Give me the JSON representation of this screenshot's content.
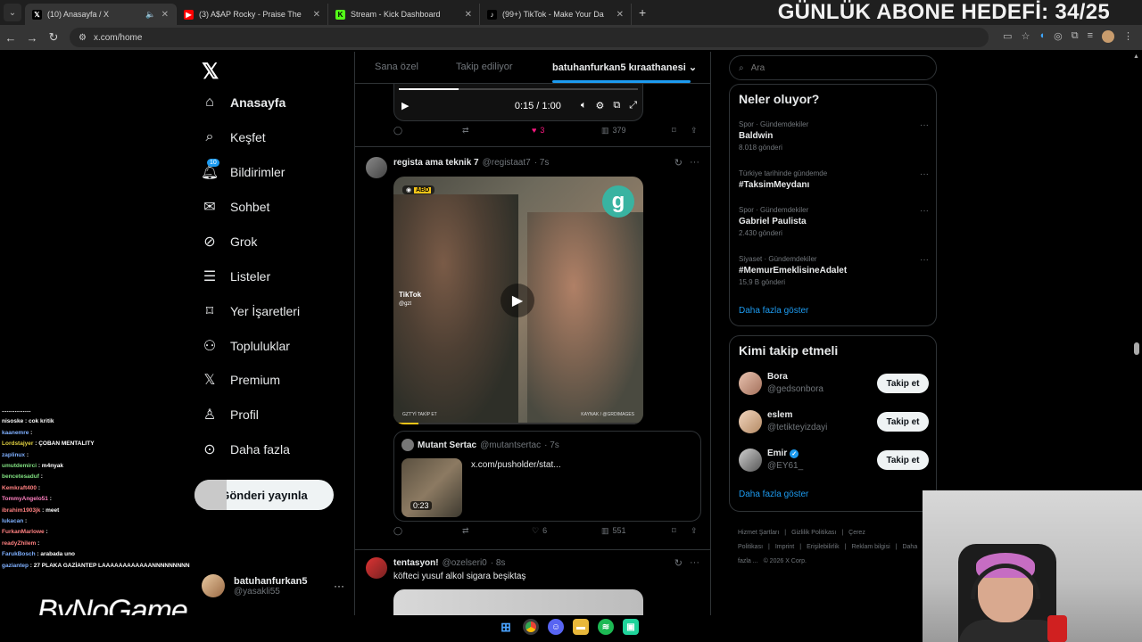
{
  "browser": {
    "tabs": [
      {
        "title": "(10) Anasayfa / X",
        "icon": "x-icon",
        "active": true
      },
      {
        "title": "(3) A$AP Rocky - Praise The",
        "icon": "youtube-icon",
        "active": false
      },
      {
        "title": "Stream - Kick Dashboard",
        "icon": "kick-icon",
        "active": false
      },
      {
        "title": "(99+) TikTok - Make Your Da",
        "icon": "tiktok-icon",
        "active": false
      }
    ],
    "url": "x.com/home"
  },
  "overlay": {
    "goal": "GÜNLÜK ABONE HEDEFİ: 34/25",
    "brand": "ByNoGame"
  },
  "leftnav": {
    "items": [
      {
        "label": "Anasayfa",
        "icon": "home-icon"
      },
      {
        "label": "Keşfet",
        "icon": "search-icon"
      },
      {
        "label": "Bildirimler",
        "icon": "bell-icon",
        "badge": "10"
      },
      {
        "label": "Sohbet",
        "icon": "mail-icon"
      },
      {
        "label": "Grok",
        "icon": "grok-icon"
      },
      {
        "label": "Listeler",
        "icon": "list-icon"
      },
      {
        "label": "Yer İşaretleri",
        "icon": "bookmark-icon"
      },
      {
        "label": "Topluluklar",
        "icon": "communities-icon"
      },
      {
        "label": "Premium",
        "icon": "x-icon"
      },
      {
        "label": "Profil",
        "icon": "person-icon"
      },
      {
        "label": "Daha fazla",
        "icon": "more-circle-icon"
      }
    ],
    "post_button": "Gönderi yayınla",
    "account": {
      "name": "batuhanfurkan5",
      "handle": "@yasakli55"
    }
  },
  "chat": [
    {
      "user": "",
      "msg": ".................."
    },
    {
      "user": "nisoske",
      "msg": ": cok kritik",
      "color": "#ffffff"
    },
    {
      "user": "kaanemre",
      "msg": ":",
      "color": "#7fb0ff"
    },
    {
      "user": "Lordstajyer",
      "msg": ": ÇOBAN MENTALITY",
      "color": "#e0d040"
    },
    {
      "user": "zaplinux",
      "msg": ":",
      "color": "#7fb0ff"
    },
    {
      "user": "umutdemirci",
      "msg": ": m4nyak",
      "color": "#80e080"
    },
    {
      "user": "bencetesaduf",
      "msg": ":",
      "color": "#80e080"
    },
    {
      "user": "Kemkraft400",
      "msg": ":",
      "color": "#ff8080"
    },
    {
      "user": "TommyAngelo51",
      "msg": ":",
      "color": "#ff80c0"
    },
    {
      "user": "ibrahim1903jk",
      "msg": ": meet",
      "color": "#ff8080"
    },
    {
      "user": "lukacan",
      "msg": ":",
      "color": "#7fb0ff"
    },
    {
      "user": "FurkanMarlowe",
      "msg": ":",
      "color": "#ff8080"
    },
    {
      "user": "readyZhilem",
      "msg": ":",
      "color": "#ff8080"
    },
    {
      "user": "FarukBosch",
      "msg": ": arabada uno",
      "color": "#7fb0ff"
    },
    {
      "user": "gaziantep",
      "msg": ": 27 PLAKA GAZİANTEP LAAAAAAAAAAAANNNNNNNNN",
      "color": "#7fb0ff"
    }
  ],
  "timeline": {
    "tabs": [
      "Sana özel",
      "Takip ediliyor",
      "batuhanfurkan5 kıraathanesi"
    ],
    "video_controls": {
      "time": "0:15 / 1:00",
      "progress": 0.25
    },
    "post0_actions": {
      "likes": "3",
      "views": "379"
    },
    "post1": {
      "name": "regista ama teknik 7",
      "handle": "@registaat7",
      "time": "· 7s",
      "media_badge": "ABD",
      "media_logo": "g",
      "media_watermark": "TikTok",
      "media_watermark_handle": "@gzt",
      "media_foot_left": "GZT'Yİ TAKİP ET",
      "media_foot_right": "KAYNAK / @GRDIMAGES",
      "quote": {
        "name": "Mutant Sertac",
        "handle": "@mutantsertac",
        "time": "· 7s",
        "link": "x.com/pusholder/stat...",
        "duration": "0:23"
      },
      "actions": {
        "likes": "6",
        "views": "551"
      }
    },
    "post2": {
      "name": "tentasyon!",
      "handle": "@ozelseri0",
      "time": "· 8s",
      "text": "köfteci yusuf alkol sigara beşiktaş"
    }
  },
  "right": {
    "search_placeholder": "Ara",
    "trends_title": "Neler oluyor?",
    "trends": [
      {
        "meta": "Spor · Gündemdekiler",
        "name": "Baldwin",
        "count": "8.018 gönderi"
      },
      {
        "meta": "Türkiye tarihinde gündemde",
        "name": "#TaksimMeydanı",
        "count": ""
      },
      {
        "meta": "Spor · Gündemdekiler",
        "name": "Gabriel Paulista",
        "count": "2.430 gönderi"
      },
      {
        "meta": "Siyaset · Gündemdekiler",
        "name": "#MemurEmeklisineAdalet",
        "count": "15,9 B gönderi"
      }
    ],
    "show_more": "Daha fazla göster",
    "who_title": "Kimi takip etmeli",
    "who": [
      {
        "name": "Bora",
        "handle": "@gedsonbora",
        "verified": false
      },
      {
        "name": "eslem",
        "handle": "@tetikteyizdayi",
        "verified": false
      },
      {
        "name": "Emir",
        "handle": "@EY61_",
        "verified": true
      }
    ],
    "follow_label": "Takip et",
    "footer": [
      "Hizmet Şartları",
      "|",
      "Gizlilik Politikası",
      "|",
      "Çerez Politikası",
      "|",
      "Imprint",
      "|",
      "Erişilebilirlik",
      "|",
      "Reklam bilgisi",
      "|",
      "Daha fazla ...",
      "© 2026 X Corp."
    ]
  }
}
